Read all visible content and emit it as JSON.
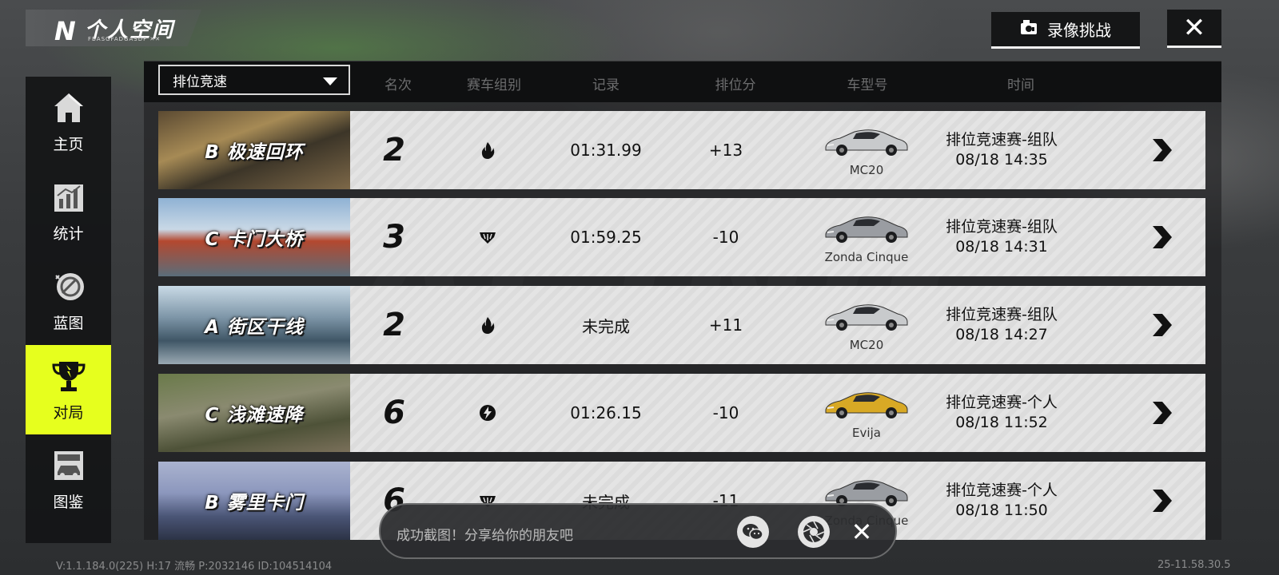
{
  "header": {
    "logo_letter": "N",
    "title": "个人空间",
    "logo_sub": "FBASGFADGASDF ✕✕",
    "record_button": "录像挑战",
    "close_glyph": "✕"
  },
  "sidebar": {
    "items": [
      {
        "label": "主页",
        "icon": "home-icon",
        "active": false
      },
      {
        "label": "统计",
        "icon": "chart-icon",
        "active": false
      },
      {
        "label": "蓝图",
        "icon": "blueprint-icon",
        "active": false
      },
      {
        "label": "对局",
        "icon": "trophy-icon",
        "active": true
      },
      {
        "label": "图鉴",
        "icon": "car-catalog-icon",
        "active": false
      }
    ]
  },
  "table": {
    "filter_value": "排位竞速",
    "columns": [
      "名次",
      "赛车组别",
      "记录",
      "排位分",
      "车型号",
      "时间"
    ],
    "rows": [
      {
        "track": "B 极速回环",
        "rank": "2",
        "class_icon": "flame-icon",
        "record": "01:31.99",
        "score": "+13",
        "car": "MC20",
        "car_color": "#c8cacc",
        "mode": "排位竞速赛-组队",
        "time": "08/18 14:35"
      },
      {
        "track": "C 卡门大桥",
        "rank": "3",
        "class_icon": "crest-icon",
        "record": "01:59.25",
        "score": "-10",
        "car": "Zonda Cinque",
        "car_color": "#9a9da2",
        "mode": "排位竞速赛-组队",
        "time": "08/18 14:31"
      },
      {
        "track": "A 街区干线",
        "rank": "2",
        "class_icon": "flame-icon",
        "record": "未完成",
        "score": "+11",
        "car": "MC20",
        "car_color": "#c8cacc",
        "mode": "排位竞速赛-组队",
        "time": "08/18 14:27"
      },
      {
        "track": "C 浅滩速降",
        "rank": "6",
        "class_icon": "bolt-icon",
        "record": "01:26.15",
        "score": "-10",
        "car": "Evija",
        "car_color": "#d8a925",
        "mode": "排位竞速赛-个人",
        "time": "08/18 11:52"
      },
      {
        "track": "B 雾里卡门",
        "rank": "6",
        "class_icon": "crest-icon",
        "record": "未完成",
        "score": "-11",
        "car": "Zonda Cinque",
        "car_color": "#9a9da2",
        "mode": "排位竞速赛-个人",
        "time": "08/18 11:50"
      }
    ]
  },
  "toast": {
    "message": "成功截图！分享给你的朋友吧",
    "close_glyph": "✕"
  },
  "footer": {
    "version": "V:1.1.184.0(225) H:17 流畅 P:2032146 ID:104514104",
    "clock": "25-11.58.30.5"
  },
  "colors": {
    "accent": "#e6ff1e",
    "row_bg": "#e2e2e2",
    "dark": "#0f1011"
  }
}
